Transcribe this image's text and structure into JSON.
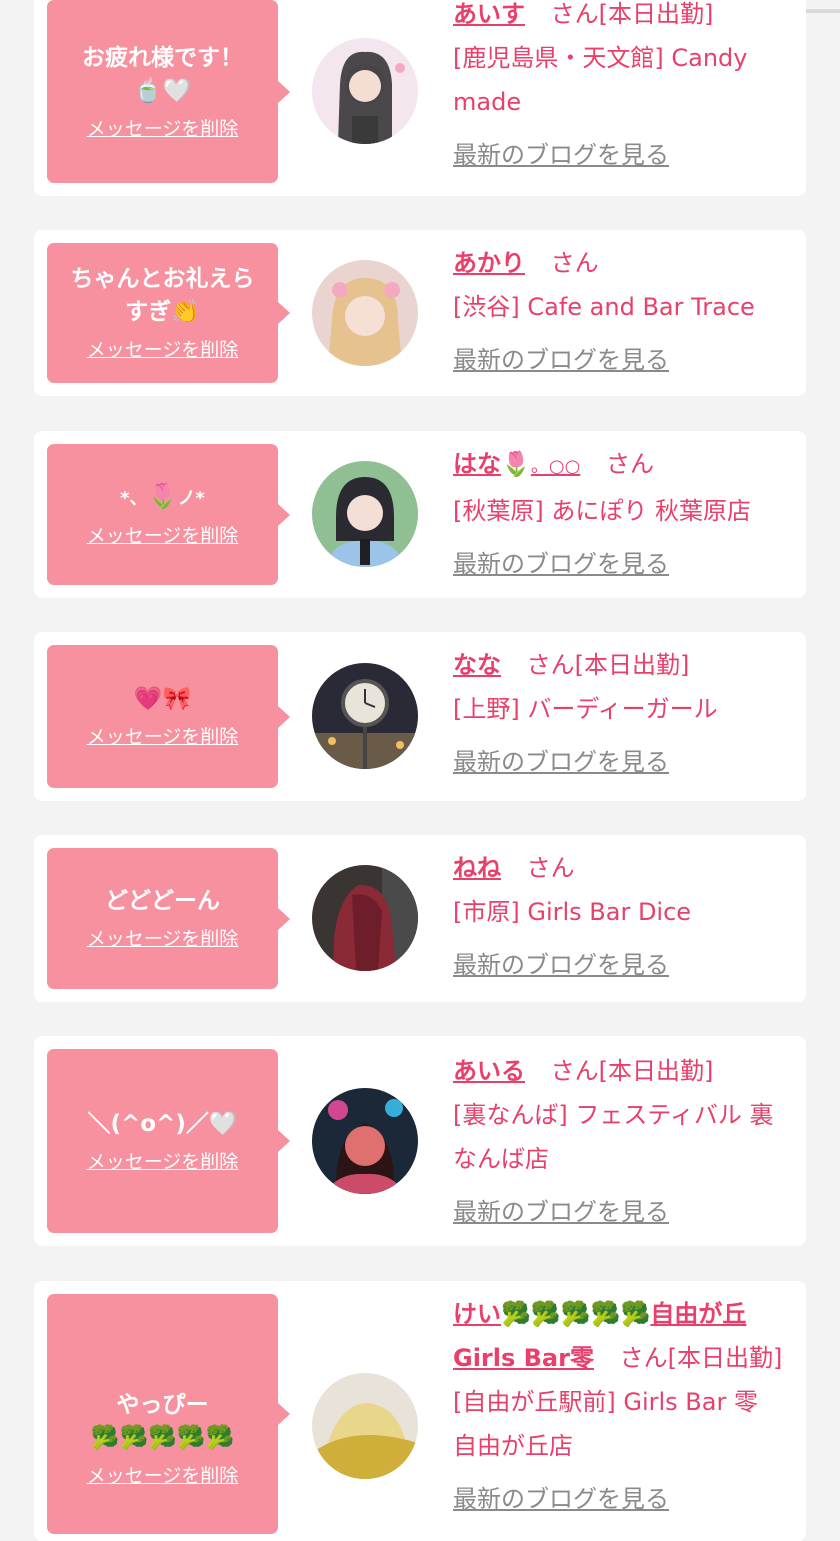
{
  "colors": {
    "accent": "#e8406a",
    "bubble": "#f7909f",
    "background": "#f3f3f3",
    "muted": "#8a8a8a"
  },
  "delete_label": "メッセージを削除",
  "blog_label": "最新のブログを見る",
  "items": [
    {
      "message_text": "お疲れ様です！",
      "message_emoji": "🍵🤍",
      "name": "あいす",
      "san": "さん",
      "attend": "[本日出勤]",
      "shop": "[鹿児島県・天文館] Candy made"
    },
    {
      "message_text": "ちゃんとお礼えらすぎ",
      "message_emoji": "👏",
      "name": "あかり",
      "san": "さん",
      "attend": "",
      "shop": "[渋谷] Cafe and Bar Trace"
    },
    {
      "message_text": "*、",
      "message_emoji": "🌷",
      "message_suffix": "ノ*",
      "name": "はな",
      "name_emoji": "🌷",
      "name_suffix": "。○○",
      "san": "さん",
      "attend": "",
      "shop": "[秋葉原] あにぽり 秋葉原店"
    },
    {
      "message_text": "",
      "message_emoji": "💗🎀",
      "name": "なな",
      "san": "さん",
      "attend": "[本日出勤]",
      "shop": "[上野] バーディーガール"
    },
    {
      "message_text": "どどどーん",
      "message_emoji": "",
      "name": "ねね",
      "san": "さん",
      "attend": "",
      "shop": "[市原] Girls Bar Dice"
    },
    {
      "message_text": "＼(^o^)／",
      "message_emoji": "🤍",
      "name": "あいる",
      "san": "さん",
      "attend": "[本日出勤]",
      "shop": "[裏なんば] フェスティバル 裏なんば店"
    },
    {
      "message_text": "やっぴー",
      "message_emoji": "🥦🥦🥦🥦🥦",
      "name": "けい",
      "name_emoji": "🥦🥦🥦🥦🥦",
      "name_suffix": "自由が丘Girls Bar零",
      "san": "さん",
      "attend": "[本日出勤]",
      "shop": "[自由が丘駅前] Girls Bar 零　自由が丘店"
    }
  ]
}
